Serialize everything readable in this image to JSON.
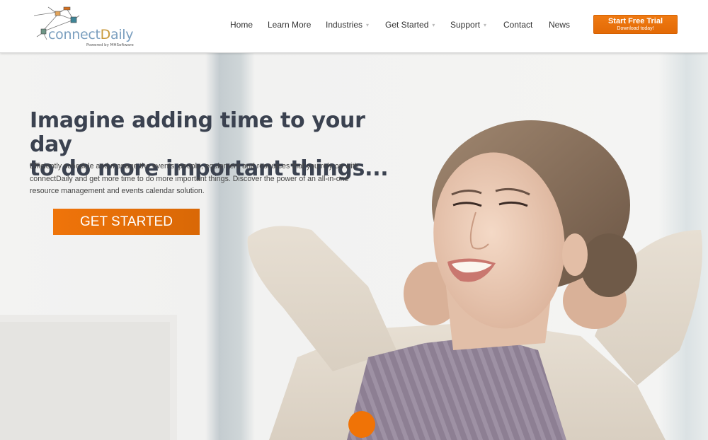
{
  "brand": {
    "name_prefix": "connect",
    "name_highlight": "D",
    "name_suffix": "aily",
    "tagline": "Powered by MHSoftware",
    "colors": {
      "primary_text": "#7b9fbf",
      "highlight": "#c99a3c"
    }
  },
  "nav": {
    "items": [
      {
        "label": "Home",
        "has_dropdown": false
      },
      {
        "label": "Learn More",
        "has_dropdown": false
      },
      {
        "label": "Industries",
        "has_dropdown": true
      },
      {
        "label": "Get Started",
        "has_dropdown": true
      },
      {
        "label": "Support",
        "has_dropdown": true
      },
      {
        "label": "Contact",
        "has_dropdown": false
      },
      {
        "label": "News",
        "has_dropdown": false
      }
    ],
    "dropdown_glyph": "▾",
    "trial_button": {
      "title": "Start Free Trial",
      "subtitle": "Download today!"
    }
  },
  "hero": {
    "headline_line1": "Imagine adding time to your day",
    "headline_line2": "to do more important things...",
    "description": "Efficiently schedule and manage the events, people, equipment and resources that you rely on with connectDaily and get more time to do more important things. Discover the power of an all-in-one resource management and events calendar solution.",
    "cta_label": "GET STARTED",
    "image_subject": "smiling woman relaxing with hands behind head"
  },
  "colors": {
    "accent": "#f07306",
    "headline": "#3b4250",
    "body_text": "#444444"
  }
}
